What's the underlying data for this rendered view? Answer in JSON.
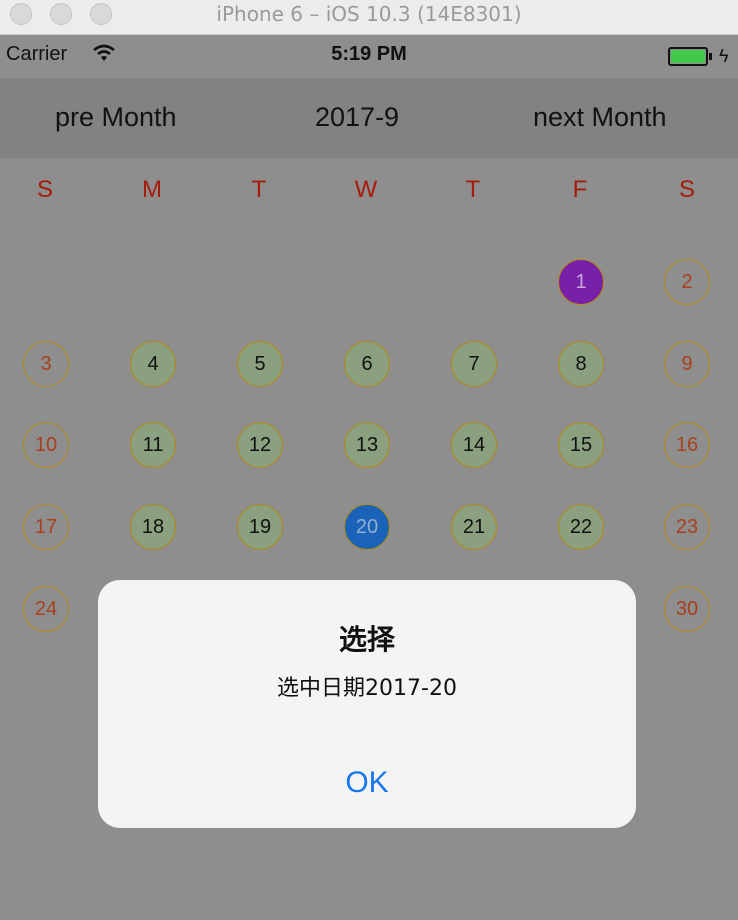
{
  "window": {
    "title": "iPhone 6 – iOS 10.3 (14E8301)"
  },
  "status_bar": {
    "carrier": "Carrier",
    "time": "5:19 PM",
    "battery_color": "#42c94c"
  },
  "nav": {
    "prev": "pre Month",
    "current": "2017-9",
    "next": "next Month"
  },
  "weekdays": [
    "S",
    "M",
    "T",
    "W",
    "T",
    "F",
    "S"
  ],
  "calendar": {
    "today": "1",
    "selected": "20",
    "visible_days": [
      "1",
      "2",
      "3",
      "4",
      "5",
      "6",
      "7",
      "8",
      "9",
      "10",
      "11",
      "12",
      "13",
      "14",
      "15",
      "16",
      "17",
      "18",
      "19",
      "20",
      "21",
      "22",
      "23",
      "24",
      "30"
    ]
  },
  "alert": {
    "title": "选择",
    "message": "选中日期2017-20",
    "button": "OK"
  },
  "colors": {
    "weekend_text": "#a8401e",
    "weekday_fill": "#8aa07e",
    "today_fill": "#7720a8",
    "selected_fill": "#1a63b8",
    "alert_button": "#1677f0"
  }
}
